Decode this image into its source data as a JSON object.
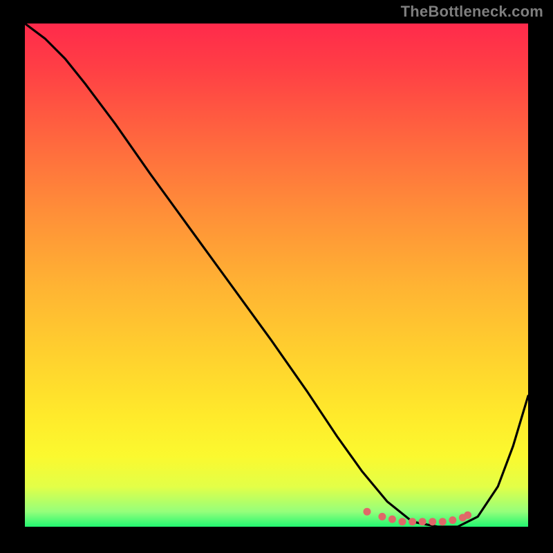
{
  "watermark": "TheBottleneck.com",
  "chart_data": {
    "type": "line",
    "title": "",
    "xlabel": "",
    "ylabel": "",
    "xlim": [
      0,
      100
    ],
    "ylim": [
      0,
      100
    ],
    "grid": false,
    "legend": false,
    "background_gradient": {
      "top": "#ff2a4b",
      "mid": "#ffd12e",
      "bottom": "#22f771"
    },
    "series": [
      {
        "name": "curve",
        "color": "#000000",
        "x": [
          0,
          4,
          8,
          12,
          18,
          25,
          33,
          41,
          49,
          56,
          62,
          67,
          72,
          77,
          82,
          86,
          90,
          94,
          97,
          100
        ],
        "values": [
          100,
          97,
          93,
          88,
          80,
          70,
          59,
          48,
          37,
          27,
          18,
          11,
          5,
          1,
          0,
          0,
          2,
          8,
          16,
          26
        ]
      }
    ],
    "markers": {
      "name": "bottom-dots",
      "color": "#e06868",
      "x": [
        68,
        71,
        73,
        75,
        77,
        79,
        81,
        83,
        85,
        87,
        88
      ],
      "values": [
        3,
        2,
        1.5,
        1,
        1,
        1,
        1,
        1,
        1.3,
        1.8,
        2.3
      ]
    }
  }
}
